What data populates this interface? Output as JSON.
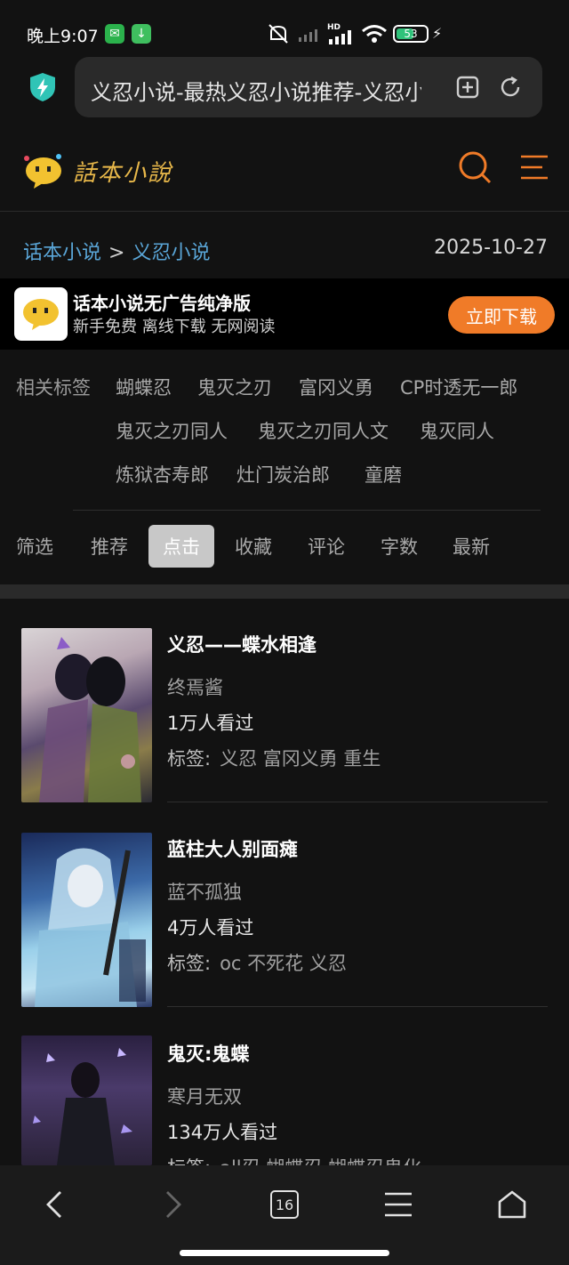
{
  "status_bar": {
    "time": "晚上9:07",
    "battery": "53",
    "network_label": "HD",
    "colors": {
      "wechat": "#2bb24c",
      "download": "#3fbf5f",
      "battery": "#2fc27a"
    }
  },
  "browser": {
    "url_title": "义忍小说-最热义忍小说推荐-义忍小说排行",
    "tab_count": "16"
  },
  "site": {
    "logo_text": "話本小說",
    "breadcrumb": {
      "home": "话本小说",
      "separator": ">",
      "current": "义忍小说"
    },
    "date": "2025-10-27",
    "accent_color": "#f07b28"
  },
  "banner": {
    "title": "话本小说无广告纯净版",
    "subtitle": "新手免费 离线下载 无网阅读",
    "button": "立即下载"
  },
  "tags": {
    "label": "相关标签",
    "items": [
      "蝴蝶忍",
      "鬼灭之刃",
      "富冈义勇",
      "CP时透无一郎",
      "鬼灭之刃同人",
      "鬼灭之刃同人文",
      "鬼灭同人",
      "炼狱杏寿郎",
      "灶门炭治郎",
      "童磨"
    ]
  },
  "filters": {
    "items": [
      "筛选",
      "推荐",
      "点击",
      "收藏",
      "评论",
      "字数",
      "最新"
    ],
    "active": "点击"
  },
  "tag_prefix": "标签:",
  "books": [
    {
      "title": "义忍——蝶水相逢",
      "author": "终焉酱",
      "views": "1万人看过",
      "tags": "义忍 富冈义勇 重生"
    },
    {
      "title": "蓝柱大人别面瘫",
      "author": "蓝不孤独",
      "views": "4万人看过",
      "tags": "oc 不死花 义忍"
    },
    {
      "title": "鬼灭:鬼蝶",
      "author": "寒月无双",
      "views": "134万人看过",
      "tags": "all忍 蝴蝶忍 蝴蝶忍鬼化"
    }
  ]
}
